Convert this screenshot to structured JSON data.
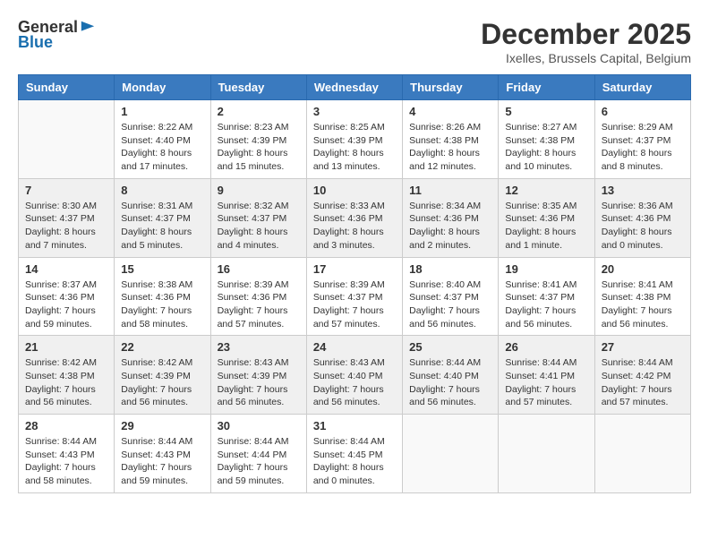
{
  "logo": {
    "general": "General",
    "blue": "Blue"
  },
  "title": "December 2025",
  "location": "Ixelles, Brussels Capital, Belgium",
  "days_of_week": [
    "Sunday",
    "Monday",
    "Tuesday",
    "Wednesday",
    "Thursday",
    "Friday",
    "Saturday"
  ],
  "weeks": [
    [
      {
        "day": "",
        "sunrise": "",
        "sunset": "",
        "daylight": ""
      },
      {
        "day": "1",
        "sunrise": "Sunrise: 8:22 AM",
        "sunset": "Sunset: 4:40 PM",
        "daylight": "Daylight: 8 hours and 17 minutes."
      },
      {
        "day": "2",
        "sunrise": "Sunrise: 8:23 AM",
        "sunset": "Sunset: 4:39 PM",
        "daylight": "Daylight: 8 hours and 15 minutes."
      },
      {
        "day": "3",
        "sunrise": "Sunrise: 8:25 AM",
        "sunset": "Sunset: 4:39 PM",
        "daylight": "Daylight: 8 hours and 13 minutes."
      },
      {
        "day": "4",
        "sunrise": "Sunrise: 8:26 AM",
        "sunset": "Sunset: 4:38 PM",
        "daylight": "Daylight: 8 hours and 12 minutes."
      },
      {
        "day": "5",
        "sunrise": "Sunrise: 8:27 AM",
        "sunset": "Sunset: 4:38 PM",
        "daylight": "Daylight: 8 hours and 10 minutes."
      },
      {
        "day": "6",
        "sunrise": "Sunrise: 8:29 AM",
        "sunset": "Sunset: 4:37 PM",
        "daylight": "Daylight: 8 hours and 8 minutes."
      }
    ],
    [
      {
        "day": "7",
        "sunrise": "Sunrise: 8:30 AM",
        "sunset": "Sunset: 4:37 PM",
        "daylight": "Daylight: 8 hours and 7 minutes."
      },
      {
        "day": "8",
        "sunrise": "Sunrise: 8:31 AM",
        "sunset": "Sunset: 4:37 PM",
        "daylight": "Daylight: 8 hours and 5 minutes."
      },
      {
        "day": "9",
        "sunrise": "Sunrise: 8:32 AM",
        "sunset": "Sunset: 4:37 PM",
        "daylight": "Daylight: 8 hours and 4 minutes."
      },
      {
        "day": "10",
        "sunrise": "Sunrise: 8:33 AM",
        "sunset": "Sunset: 4:36 PM",
        "daylight": "Daylight: 8 hours and 3 minutes."
      },
      {
        "day": "11",
        "sunrise": "Sunrise: 8:34 AM",
        "sunset": "Sunset: 4:36 PM",
        "daylight": "Daylight: 8 hours and 2 minutes."
      },
      {
        "day": "12",
        "sunrise": "Sunrise: 8:35 AM",
        "sunset": "Sunset: 4:36 PM",
        "daylight": "Daylight: 8 hours and 1 minute."
      },
      {
        "day": "13",
        "sunrise": "Sunrise: 8:36 AM",
        "sunset": "Sunset: 4:36 PM",
        "daylight": "Daylight: 8 hours and 0 minutes."
      }
    ],
    [
      {
        "day": "14",
        "sunrise": "Sunrise: 8:37 AM",
        "sunset": "Sunset: 4:36 PM",
        "daylight": "Daylight: 7 hours and 59 minutes."
      },
      {
        "day": "15",
        "sunrise": "Sunrise: 8:38 AM",
        "sunset": "Sunset: 4:36 PM",
        "daylight": "Daylight: 7 hours and 58 minutes."
      },
      {
        "day": "16",
        "sunrise": "Sunrise: 8:39 AM",
        "sunset": "Sunset: 4:36 PM",
        "daylight": "Daylight: 7 hours and 57 minutes."
      },
      {
        "day": "17",
        "sunrise": "Sunrise: 8:39 AM",
        "sunset": "Sunset: 4:37 PM",
        "daylight": "Daylight: 7 hours and 57 minutes."
      },
      {
        "day": "18",
        "sunrise": "Sunrise: 8:40 AM",
        "sunset": "Sunset: 4:37 PM",
        "daylight": "Daylight: 7 hours and 56 minutes."
      },
      {
        "day": "19",
        "sunrise": "Sunrise: 8:41 AM",
        "sunset": "Sunset: 4:37 PM",
        "daylight": "Daylight: 7 hours and 56 minutes."
      },
      {
        "day": "20",
        "sunrise": "Sunrise: 8:41 AM",
        "sunset": "Sunset: 4:38 PM",
        "daylight": "Daylight: 7 hours and 56 minutes."
      }
    ],
    [
      {
        "day": "21",
        "sunrise": "Sunrise: 8:42 AM",
        "sunset": "Sunset: 4:38 PM",
        "daylight": "Daylight: 7 hours and 56 minutes."
      },
      {
        "day": "22",
        "sunrise": "Sunrise: 8:42 AM",
        "sunset": "Sunset: 4:39 PM",
        "daylight": "Daylight: 7 hours and 56 minutes."
      },
      {
        "day": "23",
        "sunrise": "Sunrise: 8:43 AM",
        "sunset": "Sunset: 4:39 PM",
        "daylight": "Daylight: 7 hours and 56 minutes."
      },
      {
        "day": "24",
        "sunrise": "Sunrise: 8:43 AM",
        "sunset": "Sunset: 4:40 PM",
        "daylight": "Daylight: 7 hours and 56 minutes."
      },
      {
        "day": "25",
        "sunrise": "Sunrise: 8:44 AM",
        "sunset": "Sunset: 4:40 PM",
        "daylight": "Daylight: 7 hours and 56 minutes."
      },
      {
        "day": "26",
        "sunrise": "Sunrise: 8:44 AM",
        "sunset": "Sunset: 4:41 PM",
        "daylight": "Daylight: 7 hours and 57 minutes."
      },
      {
        "day": "27",
        "sunrise": "Sunrise: 8:44 AM",
        "sunset": "Sunset: 4:42 PM",
        "daylight": "Daylight: 7 hours and 57 minutes."
      }
    ],
    [
      {
        "day": "28",
        "sunrise": "Sunrise: 8:44 AM",
        "sunset": "Sunset: 4:43 PM",
        "daylight": "Daylight: 7 hours and 58 minutes."
      },
      {
        "day": "29",
        "sunrise": "Sunrise: 8:44 AM",
        "sunset": "Sunset: 4:43 PM",
        "daylight": "Daylight: 7 hours and 59 minutes."
      },
      {
        "day": "30",
        "sunrise": "Sunrise: 8:44 AM",
        "sunset": "Sunset: 4:44 PM",
        "daylight": "Daylight: 7 hours and 59 minutes."
      },
      {
        "day": "31",
        "sunrise": "Sunrise: 8:44 AM",
        "sunset": "Sunset: 4:45 PM",
        "daylight": "Daylight: 8 hours and 0 minutes."
      },
      {
        "day": "",
        "sunrise": "",
        "sunset": "",
        "daylight": ""
      },
      {
        "day": "",
        "sunrise": "",
        "sunset": "",
        "daylight": ""
      },
      {
        "day": "",
        "sunrise": "",
        "sunset": "",
        "daylight": ""
      }
    ]
  ]
}
